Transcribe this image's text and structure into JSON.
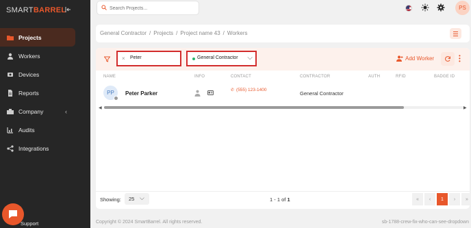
{
  "brand": {
    "prefix": "SMART",
    "accent_word": "BARREL",
    "accent_color": "#e8572b"
  },
  "topbar": {
    "search_placeholder": "Search Projects...",
    "user_initials": "PS",
    "flag": "us-flag-icon"
  },
  "sidebar": {
    "items": [
      {
        "label": "Projects",
        "icon": "folder-icon",
        "active": true
      },
      {
        "label": "Workers",
        "icon": "person-icon",
        "active": false
      },
      {
        "label": "Devices",
        "icon": "device-icon",
        "active": false
      },
      {
        "label": "Reports",
        "icon": "document-icon",
        "active": false
      },
      {
        "label": "Company",
        "icon": "building-icon",
        "active": false,
        "has_submenu": true
      },
      {
        "label": "Audits",
        "icon": "audit-icon",
        "active": false
      },
      {
        "label": "Integrations",
        "icon": "integrations-icon",
        "active": false
      }
    ],
    "support_label": "Support"
  },
  "breadcrumb": [
    "General Contractor",
    "Projects",
    "Project name 43",
    "Workers"
  ],
  "filters": {
    "search_value": "Peter",
    "contractor_value": "General Contractor",
    "add_worker_label": "Add Worker"
  },
  "table": {
    "columns": [
      "NAME",
      "INFO",
      "CONTACT",
      "CONTRACTOR",
      "AUTH",
      "RFID",
      "BADGE ID"
    ],
    "rows": [
      {
        "initials": "PP",
        "name": "Peter Parker",
        "phone": "(555) 123-1400",
        "contractor": "General Contractor"
      }
    ]
  },
  "pagination": {
    "showing_label": "Showing:",
    "per_page": "25",
    "range_prefix": "1 - 1 of ",
    "range_total": "1",
    "first": "«",
    "prev": "‹",
    "current": "1",
    "next": "›",
    "last": "»"
  },
  "footer": {
    "copyright": "Copyright © 2024 SmartBarrel. All rights reserved.",
    "branch": "sb-1788-crew-fix-who-can-see-dropdown"
  }
}
